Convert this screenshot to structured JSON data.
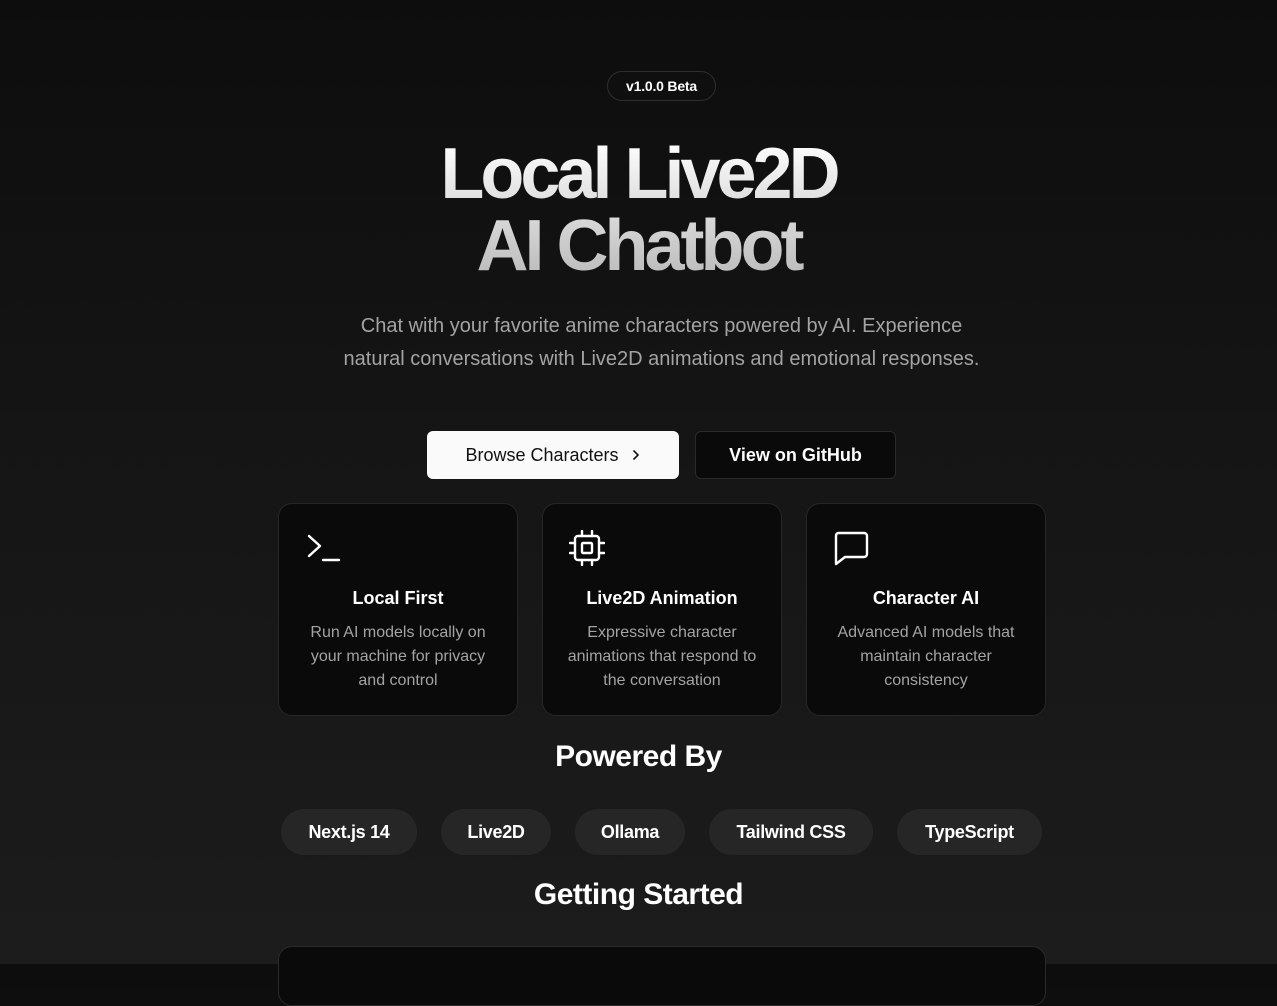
{
  "badge": "v1.0.0 Beta",
  "hero": {
    "title_line1": "Local Live2D",
    "title_line2": "AI Chatbot",
    "subtitle": "Chat with your favorite anime characters powered by AI. Experience natural conversations with Live2D animations and emotional responses."
  },
  "buttons": {
    "browse": "Browse Characters",
    "github": "View on GitHub"
  },
  "features": [
    {
      "icon": "terminal-icon",
      "title": "Local First",
      "description": "Run AI models locally on your machine for privacy and control"
    },
    {
      "icon": "cpu-chip-icon",
      "title": "Live2D Animation",
      "description": "Expressive character animations that respond to the conversation"
    },
    {
      "icon": "chat-bubble-icon",
      "title": "Character AI",
      "description": "Advanced AI models that maintain character consistency"
    }
  ],
  "powered_by": {
    "title": "Powered By",
    "items": [
      "Next.js 14",
      "Live2D",
      "Ollama",
      "Tailwind CSS",
      "TypeScript"
    ]
  },
  "getting_started": {
    "title": "Getting Started"
  },
  "colors": {
    "background": "#0d0d0d",
    "card": "#0a0a0a",
    "muted_text": "#a3a3a3",
    "pill": "#262626",
    "primary_button": "#fafafa"
  }
}
